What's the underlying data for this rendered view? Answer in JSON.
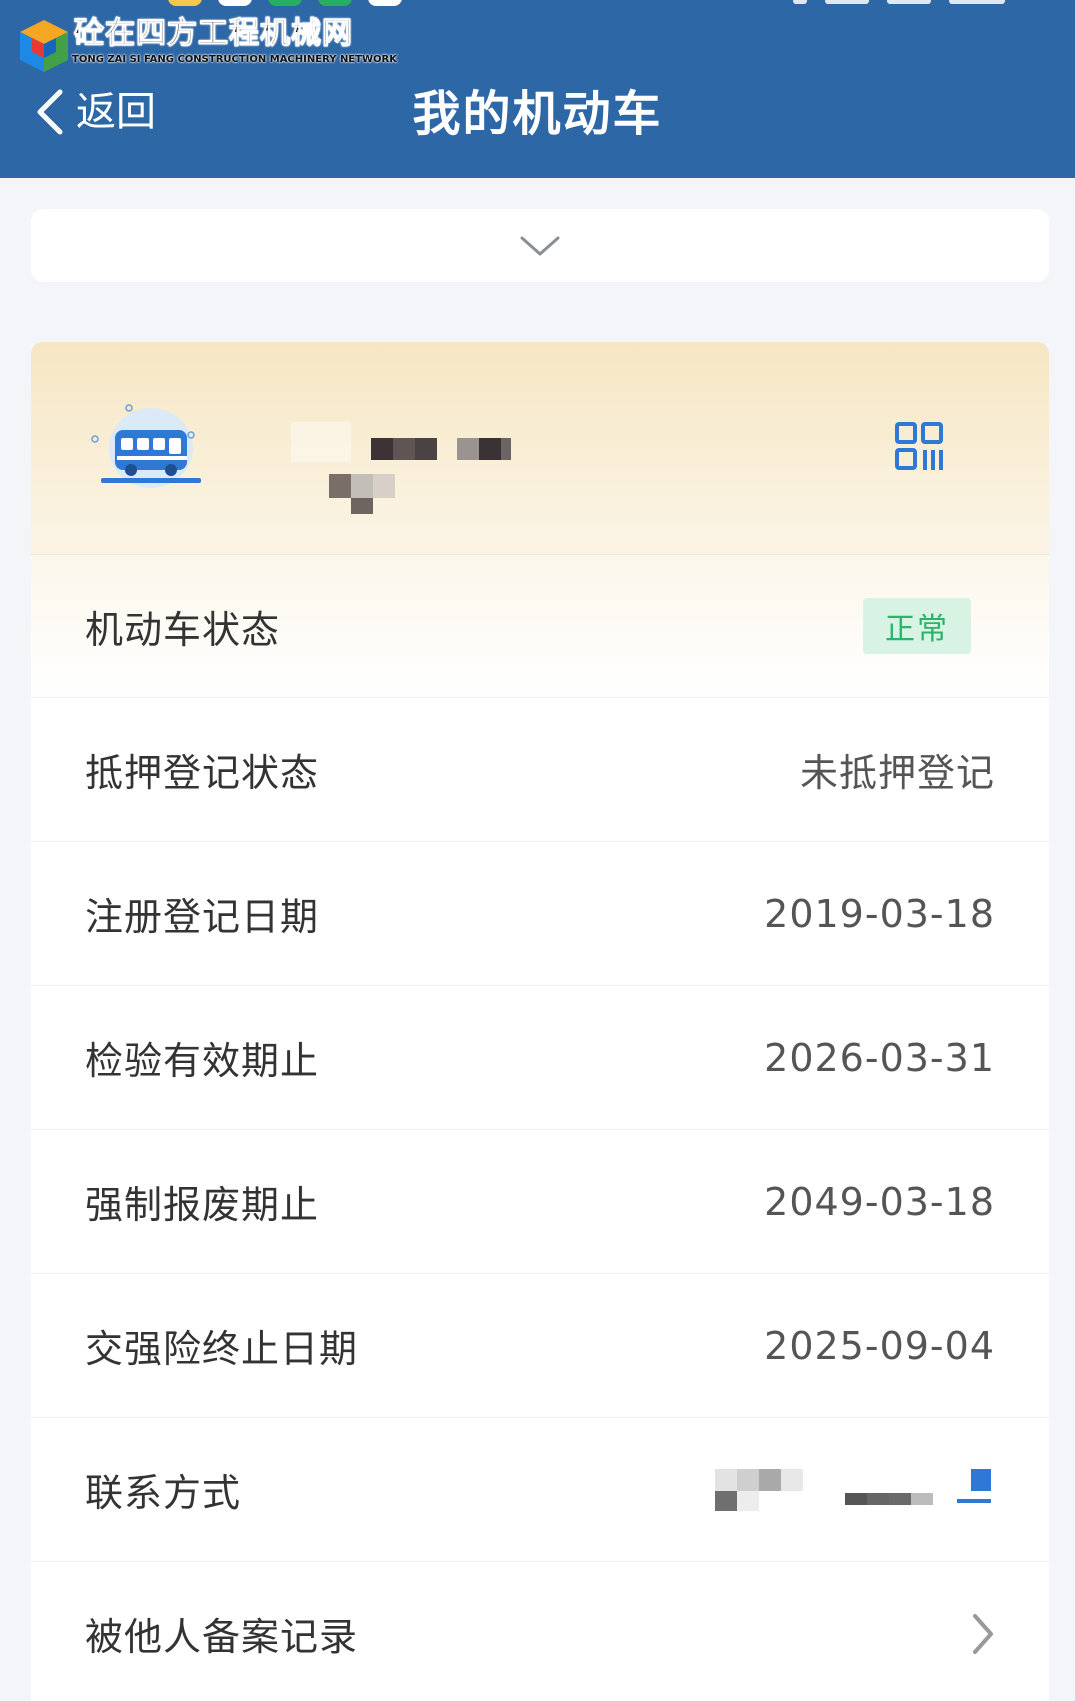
{
  "watermark": {
    "name": "砼在四方工程机械网",
    "tagline": "TONG ZAI SI FANG CONSTRUCTION MACHINERY NETWORK"
  },
  "header": {
    "back_label": "返回",
    "title": "我的机动车"
  },
  "vehicle_card": {
    "rows": [
      {
        "label": "机动车状态",
        "value": "正常"
      },
      {
        "label": "抵押登记状态",
        "value": "未抵押登记"
      },
      {
        "label": "注册登记日期",
        "value": "2019-03-18"
      },
      {
        "label": "检验有效期止",
        "value": "2026-03-31"
      },
      {
        "label": "强制报废期止",
        "value": "2049-03-18"
      },
      {
        "label": "交强险终止日期",
        "value": "2025-09-04"
      },
      {
        "label": "联系方式",
        "value": ""
      },
      {
        "label": "被他人备案记录",
        "value": ""
      }
    ]
  },
  "colors": {
    "header_bg": "#2e67a6",
    "status_badge_bg": "#d8f3e4",
    "status_badge_text": "#2bb36a",
    "accent_blue": "#2e78d6"
  },
  "icons": {
    "back": "chevron-left-icon",
    "collapse": "chevron-down-icon",
    "vehicle": "bus-icon",
    "qr": "qr-code-icon",
    "record_arrow": "chevron-right-icon"
  }
}
